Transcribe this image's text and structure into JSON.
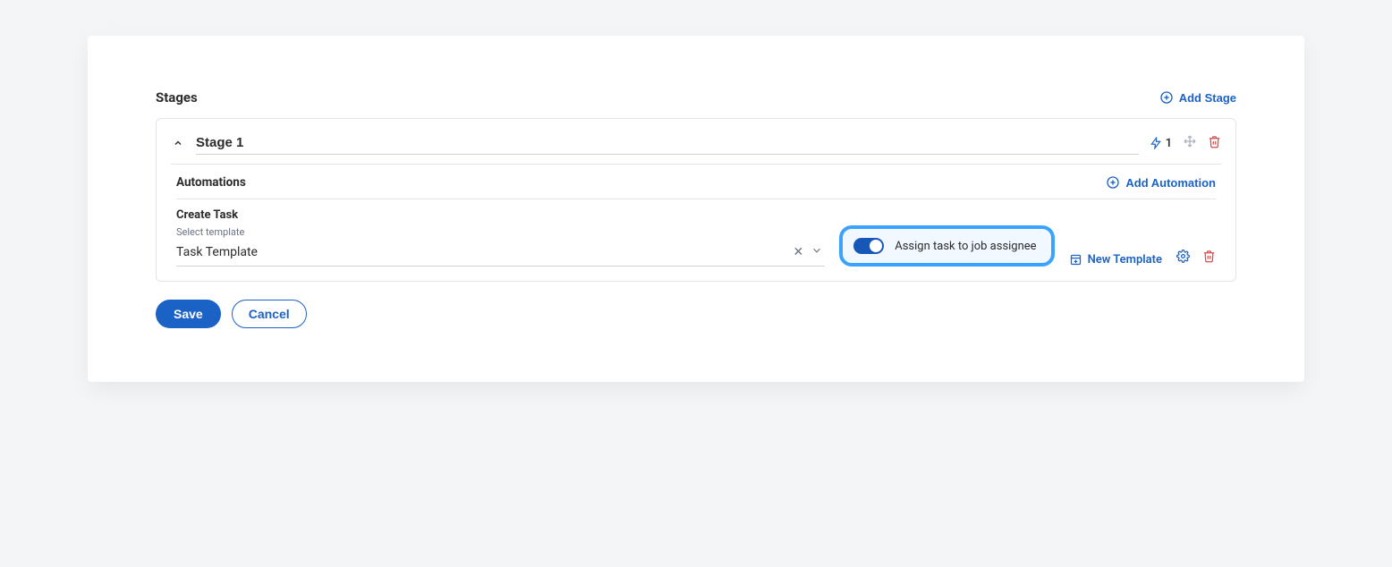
{
  "stages_header": {
    "title": "Stages",
    "add_stage_label": "Add Stage"
  },
  "stage": {
    "name": "Stage 1",
    "automation_count": "1",
    "automations_label": "Automations",
    "add_automation_label": "Add Automation"
  },
  "automation": {
    "type_label": "Create Task",
    "template_field_label": "Select template",
    "template_value": "Task Template",
    "assign_toggle_label": "Assign task to job assignee",
    "toggle_on": true,
    "new_template_label": "New Template"
  },
  "footer": {
    "save_label": "Save",
    "cancel_label": "Cancel"
  }
}
